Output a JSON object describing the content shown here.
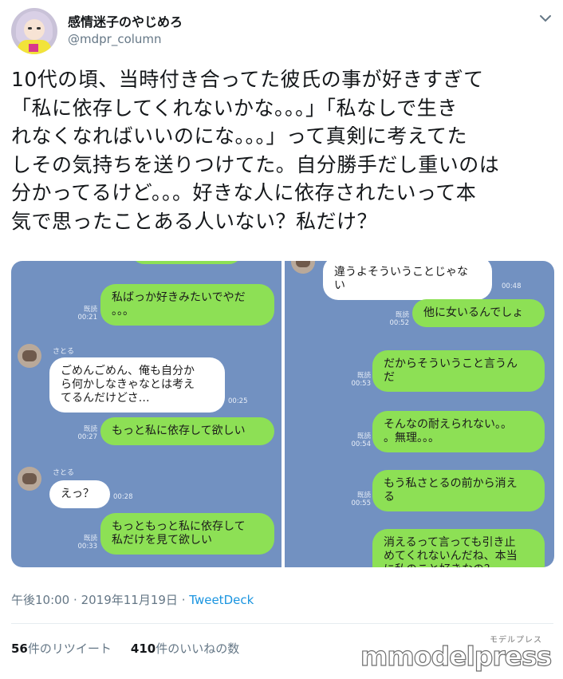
{
  "account": {
    "name": "感情迷子のやじめろ",
    "handle": "@mdpr_column"
  },
  "tweet": {
    "text": "10代の頃、当時付き合ってた彼氏の事が好きすぎて\n「私に依存してくれないかな。。。」「私なしで生き\nれなくなればいいのにな。。。」って真剣に考えてた\nしその気持ちを送りつけてた。自分勝手だし重いのは\n分かってるけど。。。好きな人に依存されたいって本\n気で思ったことある人いない？私だけ？"
  },
  "chat_left": {
    "messages": [
      {
        "text": "私ばっか好きみたいでやだ\n。。。",
        "side": "right",
        "read": "既読",
        "time": "00:21"
      },
      {
        "sender": "さとる",
        "text": "ごめんごめん、俺も自分か\nら何かしなきゃなとは考え\nてるんだけどさ…",
        "side": "left",
        "time": "00:25"
      },
      {
        "text": "もっと私に依存して欲しい",
        "side": "right",
        "read": "既読",
        "time": "00:27"
      },
      {
        "sender": "さとる",
        "text": "えっ？",
        "side": "left",
        "time": "00:28"
      },
      {
        "text": "もっともっと私に依存して\n私だけを見て欲しい",
        "side": "right",
        "read": "既読",
        "time": "00:33"
      }
    ]
  },
  "chat_right": {
    "messages": [
      {
        "text": "違うよそういうことじゃな\nい",
        "side": "left",
        "time": "00:48"
      },
      {
        "text": "他に女いるんでしょ",
        "side": "right",
        "read": "既読",
        "time": "00:52"
      },
      {
        "text": "だからそういうこと言うん\nだ",
        "side": "right",
        "read": "既読",
        "time": "00:53"
      },
      {
        "text": "そんなの耐えられない。。\n。無理。。。",
        "side": "right",
        "read": "既読",
        "time": "00:54"
      },
      {
        "text": "もう私さとるの前から消え\nる",
        "side": "right",
        "read": "既読",
        "time": "00:55"
      },
      {
        "text": "消えるって言っても引き止\nめてくれないんだね、本当\nに私のこと好きなの？",
        "side": "right",
        "read": "",
        "time": ""
      }
    ]
  },
  "footer": {
    "time": "午後10:00",
    "sep1": "·",
    "date": "2019年11月19日",
    "sep2": "·",
    "source": "TweetDeck"
  },
  "stats": {
    "retweets_count": "56",
    "retweets_label": "件のリツイート",
    "likes_count": "410",
    "likes_label": "件のいいねの数"
  },
  "watermark": {
    "small": "モデルプレス",
    "main": "mmodelpress"
  },
  "colors": {
    "chat_bg": "#7291c1",
    "bubble_green": "#8de055",
    "link_blue": "#1b95e0"
  }
}
